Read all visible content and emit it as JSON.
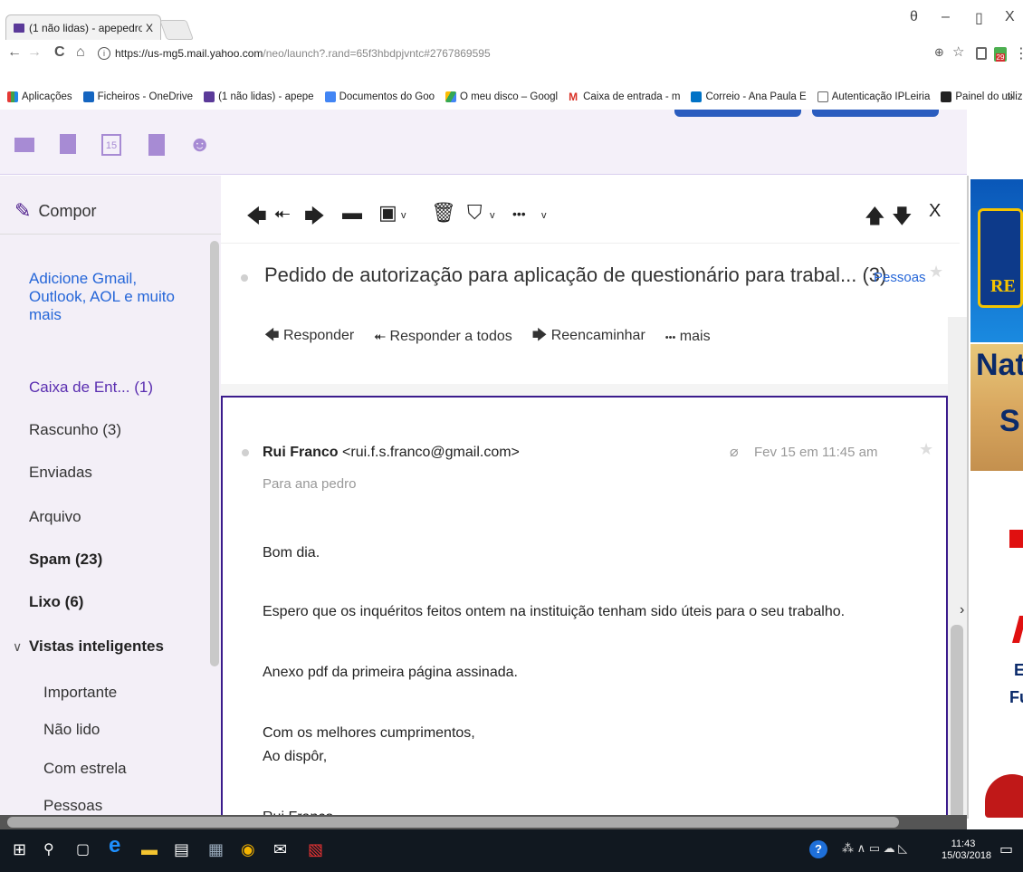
{
  "browser": {
    "tab_title": "(1 não lidas) - apepedro",
    "tab_close": "X",
    "url_host": "https://us-mg5.mail.yahoo.com",
    "url_rest": "/neo/launch?.rand=65f3hbdpjvntc#2767869595",
    "info_glyph": "i",
    "bookmarks": [
      "Aplicações",
      "Ficheiros - OneDrive",
      "(1 não lidas) - apepe",
      "Documentos do Goo",
      "O meu disco – Googl",
      "Caixa de entrada - m",
      "Correio - Ana Paula E",
      "Autenticação IPLeiria",
      "Painel do utilizador"
    ],
    "bookmarks_more": "»",
    "window_controls": {
      "account": "θ",
      "minimize": "–",
      "restore": "▯",
      "close": "X"
    },
    "nav": {
      "back": "←",
      "forward": "→",
      "reload": "C",
      "home": "⌂"
    },
    "omni_right": {
      "zoom": "⊕",
      "star": "☆",
      "menu": "⋮"
    },
    "extension_badge": "29"
  },
  "app_icons": {
    "calendar_day": "15",
    "mail": "✉",
    "contacts": "▣",
    "notepad": "▮",
    "messenger": "☻"
  },
  "sidebar": {
    "compose": "Compor",
    "add_accounts": "Adicione Gmail, Outlook, AOL e muito mais",
    "folders": [
      {
        "label": "Caixa de Ent... (1)"
      },
      {
        "label": "Rascunho (3)"
      },
      {
        "label": "Enviadas"
      },
      {
        "label": "Arquivo"
      },
      {
        "label": "Spam (23)"
      },
      {
        "label": "Lixo (6)"
      }
    ],
    "smart_views": "Vistas inteligentes",
    "smart_items": [
      "Importante",
      "Não lido",
      "Com estrela",
      "Pessoas"
    ],
    "chevron": "∨",
    "pen": "✎"
  },
  "toolbar": {
    "reply": "🡄",
    "reply_all": "⯬",
    "forward": "🡆",
    "archive": "▬",
    "move": "▣",
    "delete": "🗑",
    "spam": "⛉",
    "more": "•••",
    "caret": "v",
    "prev": "🡅",
    "next": "🡇",
    "close": "X"
  },
  "thread": {
    "subject": "Pedido de autorização para aplicação de questionário para trabal... (3)",
    "people_link": "Pessoas",
    "star": "★",
    "reply_actions": [
      "Responder",
      "Responder a todos",
      "Reencaminhar",
      "mais"
    ]
  },
  "message": {
    "sender_name": "Rui Franco",
    "sender_email": "<rui.f.s.franco@gmail.com>",
    "to_line": "Para  ana pedro",
    "date": "Fev 15 em 11:45 am",
    "attachment": "⌀",
    "body": [
      "Bom dia.",
      "Espero que os inquéritos feitos ontem na instituição tenham sido úteis para o seu trabalho.",
      "Anexo pdf da primeira página assinada.",
      "Com os melhores cumprimentos,",
      "Ao dispôr,",
      "Rui Franco"
    ]
  },
  "ad": {
    "line1": "Nat",
    "line2": "S",
    "line3": "Ec",
    "line4": "Ful",
    "logo": "RE"
  },
  "right_arrow": "›",
  "taskbar": {
    "start": "⊞",
    "search": "⚲",
    "taskview": "▢",
    "edge": "e",
    "explorer": "▬",
    "store": "▤",
    "notepad": "▦",
    "chrome": "◉",
    "mail": "✉",
    "pdf": "▧",
    "tray_icons": "⁂  ∧ ▭ ☁ ◺",
    "time": "11:43",
    "date": "15/03/2018",
    "notifications": "▭"
  },
  "colors": {
    "accent": "#5a2eb0",
    "link": "#2566d8",
    "card_border": "#3b1c8c",
    "sidebar_bg": "#f3eff7"
  }
}
